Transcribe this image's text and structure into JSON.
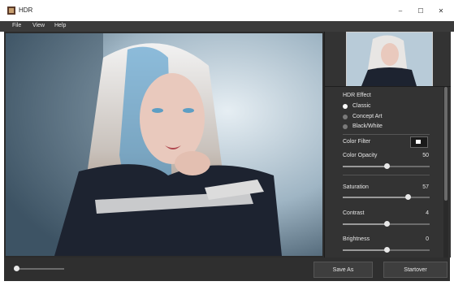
{
  "window": {
    "title": "HDR",
    "minimize_glyph": "–",
    "maximize_glyph": "☐",
    "close_glyph": "✕"
  },
  "menu": {
    "items": [
      "File",
      "View",
      "Help"
    ]
  },
  "panel": {
    "section_title": "HDR Effect",
    "effects": [
      {
        "label": "Classic",
        "selected": true
      },
      {
        "label": "Concept Art",
        "selected": false
      },
      {
        "label": "Black/White",
        "selected": false
      }
    ],
    "color_filter_label": "Color Filter",
    "color_filter_value": "#ffffff",
    "sliders": [
      {
        "label": "Color Opacity",
        "value": "50",
        "level": 0.5
      },
      {
        "label": "Saturation",
        "value": "57",
        "level": 0.75
      },
      {
        "label": "Contrast",
        "value": "4",
        "level": 0.5
      },
      {
        "label": "Brightness",
        "value": "0",
        "level": 0.5
      }
    ]
  },
  "bottom": {
    "zoom_level": 0.05,
    "save_as_label": "Save As",
    "startover_label": "Startover"
  },
  "colors": {
    "panel_bg": "#333333",
    "menubar_bg": "#3b3b3b",
    "accent_white": "#ffffff"
  }
}
